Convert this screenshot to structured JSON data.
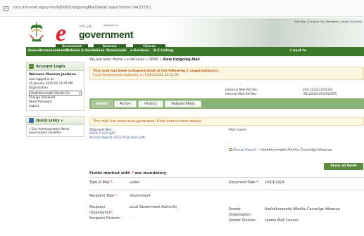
{
  "browser": {
    "url": "cms.intranet.egov.mv/GEMS/OutgoingMailDetail.aspx?mid=19433752"
  },
  "header": {
    "logo_dv": "ޖޫރަވި ސަރުކާރު",
    "logo_small": "www.gov.mv",
    "logo_word": "government",
    "toplinks": "Site Map | Contact Us | Feedback | About Us | Help"
  },
  "nav": {
    "tab_labels": [
      "Government",
      "Business",
      "Citizens"
    ],
    "items": [
      "Home",
      "Announcements",
      "Policies & Guidelines",
      "Downloads",
      "e-Services",
      "A-Z Listing"
    ],
    "iwant": "I want to"
  },
  "sidebar": {
    "account": {
      "title": "Account Login",
      "welcome": "Welcome  Moonisa Jaufaree",
      "last_login_label": "Last logged in on",
      "last_login_value": "15 January 2025 02:11:05 PM",
      "org_label": "Organisation",
      "org_value": "Hadhdhunmathi Atholhu Co",
      "change_password": "Change Password",
      "reset_password": "Reset Password",
      "logout": "Logout"
    },
    "quick": {
      "title": "Quick Links »",
      "item1": "» Gov Administration Portal",
      "item2": "Government Gazettes"
    }
  },
  "main": {
    "breadcrumb": "You are here: Home » e-Services » GEMS » ",
    "breadcrumb_current": "View Outgoing Mail",
    "alert_line1": "This mail has been autogenerated at the following 1 organisation(s):",
    "alert_line2": "Local Government Authority on 14/01/2024 22:32:06",
    "external_ref_label": "External Mail Ref No:",
    "external_ref_value": "240 CA/221/2024/2",
    "internal_ref_label": "Internal Mail Ref No:",
    "internal_ref_value": "(OU)240/LAC/2024/55",
    "tabs": [
      "Detail",
      "Action",
      "History",
      "Related Mails"
    ],
    "autogen_note": "This mail has been auto-generated. Click here to view details.",
    "attached_label": "Attached files:",
    "attached_files": [
      "2024-2 LGA.pdf",
      "Annual Report 2023 final.docx.pdf"
    ],
    "mail_cases_label": "Mail Cases:",
    "mail_cases_dash": "-",
    "mail_case_item": "Annual Report",
    "mail_case_rest": " » Hadhdhunmathi Atholhu Councilge Idhaaraa",
    "show_all": "Show all fields",
    "mandatory_prefix": "Fields marked with ",
    "mandatory_star": "*",
    "mandatory_suffix": " are mandatory",
    "type_of_mail_label": "Type of Mail",
    "type_of_mail_value": "Letter",
    "document_date_label": "Document Date",
    "document_date_value": "14/01/2024",
    "recipient_type_label": "Recipient Type",
    "recipient_type_value": "Government",
    "recipient_org_label1": "Recipient",
    "recipient_org_label2": "Organisation",
    "recipient_org_value": "Local Government Authority",
    "recipient_div_label": "Recipient Division:",
    "recipient_div_value": "-",
    "sender_label": "Sender",
    "sender_org_label": "Organisation:",
    "sender_org_value": "Hadhdhunmathi Atholhu Councilge Idhaaraa",
    "sender_div_label": "Sender Division:",
    "sender_div_value": "Laamu Atoll Council",
    "colon_star": "*:",
    "colon": ":"
  },
  "colors": {
    "nav_green": "#3d7a2c",
    "brand_red": "#e0232b",
    "alert_orange": "#b45a10",
    "button_green": "#5b8b3e"
  }
}
